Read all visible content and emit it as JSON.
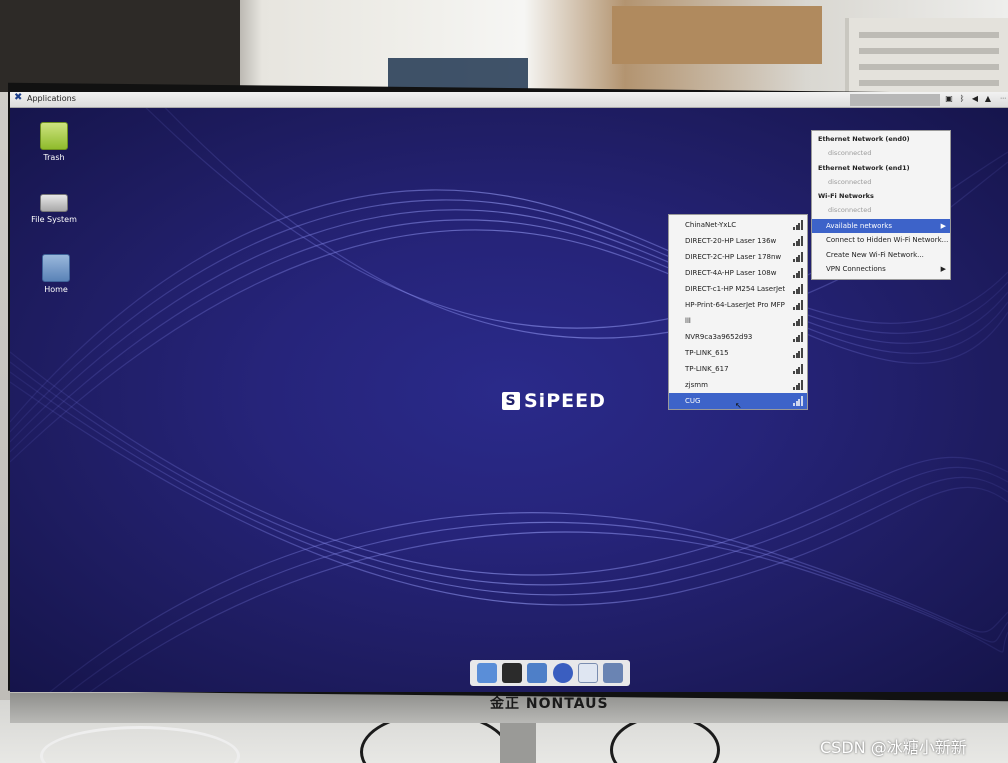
{
  "panel": {
    "applications_label": "Applications"
  },
  "desktop_icons": [
    {
      "label": "Trash",
      "icon": "trash-icon"
    },
    {
      "label": "File System",
      "icon": "drive-icon"
    },
    {
      "label": "Home",
      "icon": "home-folder-icon"
    }
  ],
  "logo": {
    "text": "SiPEED"
  },
  "network_menu": {
    "ethernet0_header": "Ethernet Network (end0)",
    "ethernet0_status": "disconnected",
    "ethernet1_header": "Ethernet Network (end1)",
    "ethernet1_status": "disconnected",
    "wifi_header": "Wi-Fi Networks",
    "wifi_status": "disconnected",
    "items": [
      {
        "label": "Available networks",
        "has_submenu": true,
        "selected": true
      },
      {
        "label": "Connect to Hidden Wi-Fi Network...",
        "has_submenu": false,
        "selected": false
      },
      {
        "label": "Create New Wi-Fi Network...",
        "has_submenu": false,
        "selected": false
      },
      {
        "label": "VPN Connections",
        "has_submenu": true,
        "selected": false
      }
    ]
  },
  "available_networks": [
    {
      "ssid": "ChinaNet-YxLC",
      "selected": false
    },
    {
      "ssid": "DIRECT-20-HP Laser 136w",
      "selected": false
    },
    {
      "ssid": "DIRECT-2C-HP Laser 178nw",
      "selected": false
    },
    {
      "ssid": "DIRECT-4A-HP Laser 108w",
      "selected": false
    },
    {
      "ssid": "DIRECT-c1-HP M254 LaserJet",
      "selected": false
    },
    {
      "ssid": "HP-Print-64-LaserJet Pro MFP",
      "selected": false
    },
    {
      "ssid": "lll",
      "selected": false
    },
    {
      "ssid": "NVR9ca3a9652d93",
      "selected": false
    },
    {
      "ssid": "TP-LINK_615",
      "selected": false
    },
    {
      "ssid": "TP-LINK_617",
      "selected": false
    },
    {
      "ssid": "zjsmm",
      "selected": false
    },
    {
      "ssid": "CUG",
      "selected": true
    }
  ],
  "monitor_brand": "金正 NÖNTAUS",
  "watermark": "CSDN @冰糖小新新",
  "colors": {
    "selection": "#3d63c9",
    "wallpaper": "#26247a"
  }
}
